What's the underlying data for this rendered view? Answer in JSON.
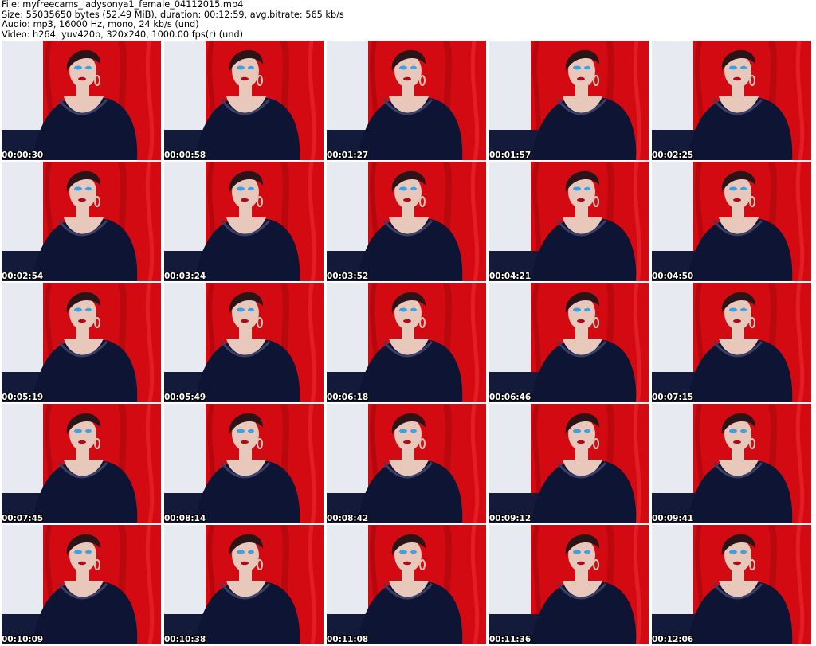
{
  "header": {
    "file_line": "File: myfreecams_ladysonya1_female_04112015.mp4",
    "size_line": "Size: 55035650 bytes (52.49 MiB), duration: 00:12:59, avg.bitrate: 565 kb/s",
    "audio_line": "Audio: mp3, 16000 Hz, mono, 24 kb/s (und)",
    "video_line": "Video: h264, yuv420p, 320x240, 1000.00 fps(r) (und)"
  },
  "thumbnails": [
    {
      "timestamp": "00:00:30"
    },
    {
      "timestamp": "00:00:58"
    },
    {
      "timestamp": "00:01:27"
    },
    {
      "timestamp": "00:01:57"
    },
    {
      "timestamp": "00:02:25"
    },
    {
      "timestamp": "00:02:54"
    },
    {
      "timestamp": "00:03:24"
    },
    {
      "timestamp": "00:03:52"
    },
    {
      "timestamp": "00:04:21"
    },
    {
      "timestamp": "00:04:50"
    },
    {
      "timestamp": "00:05:19"
    },
    {
      "timestamp": "00:05:49"
    },
    {
      "timestamp": "00:06:18"
    },
    {
      "timestamp": "00:06:46"
    },
    {
      "timestamp": "00:07:15"
    },
    {
      "timestamp": "00:07:45"
    },
    {
      "timestamp": "00:08:14"
    },
    {
      "timestamp": "00:08:42"
    },
    {
      "timestamp": "00:09:12"
    },
    {
      "timestamp": "00:09:41"
    },
    {
      "timestamp": "00:10:09"
    },
    {
      "timestamp": "00:10:38"
    },
    {
      "timestamp": "00:11:08"
    },
    {
      "timestamp": "00:11:36"
    },
    {
      "timestamp": "00:12:06"
    }
  ],
  "colors": {
    "background": "#ffffff",
    "curtain_red": "#d40a12",
    "wall_white": "#e8eaf2",
    "outfit_navy": "#0e1433",
    "hair_dark": "#2a1418",
    "skin": "#e9c8bc",
    "timestamp_text": "#ffffff"
  }
}
